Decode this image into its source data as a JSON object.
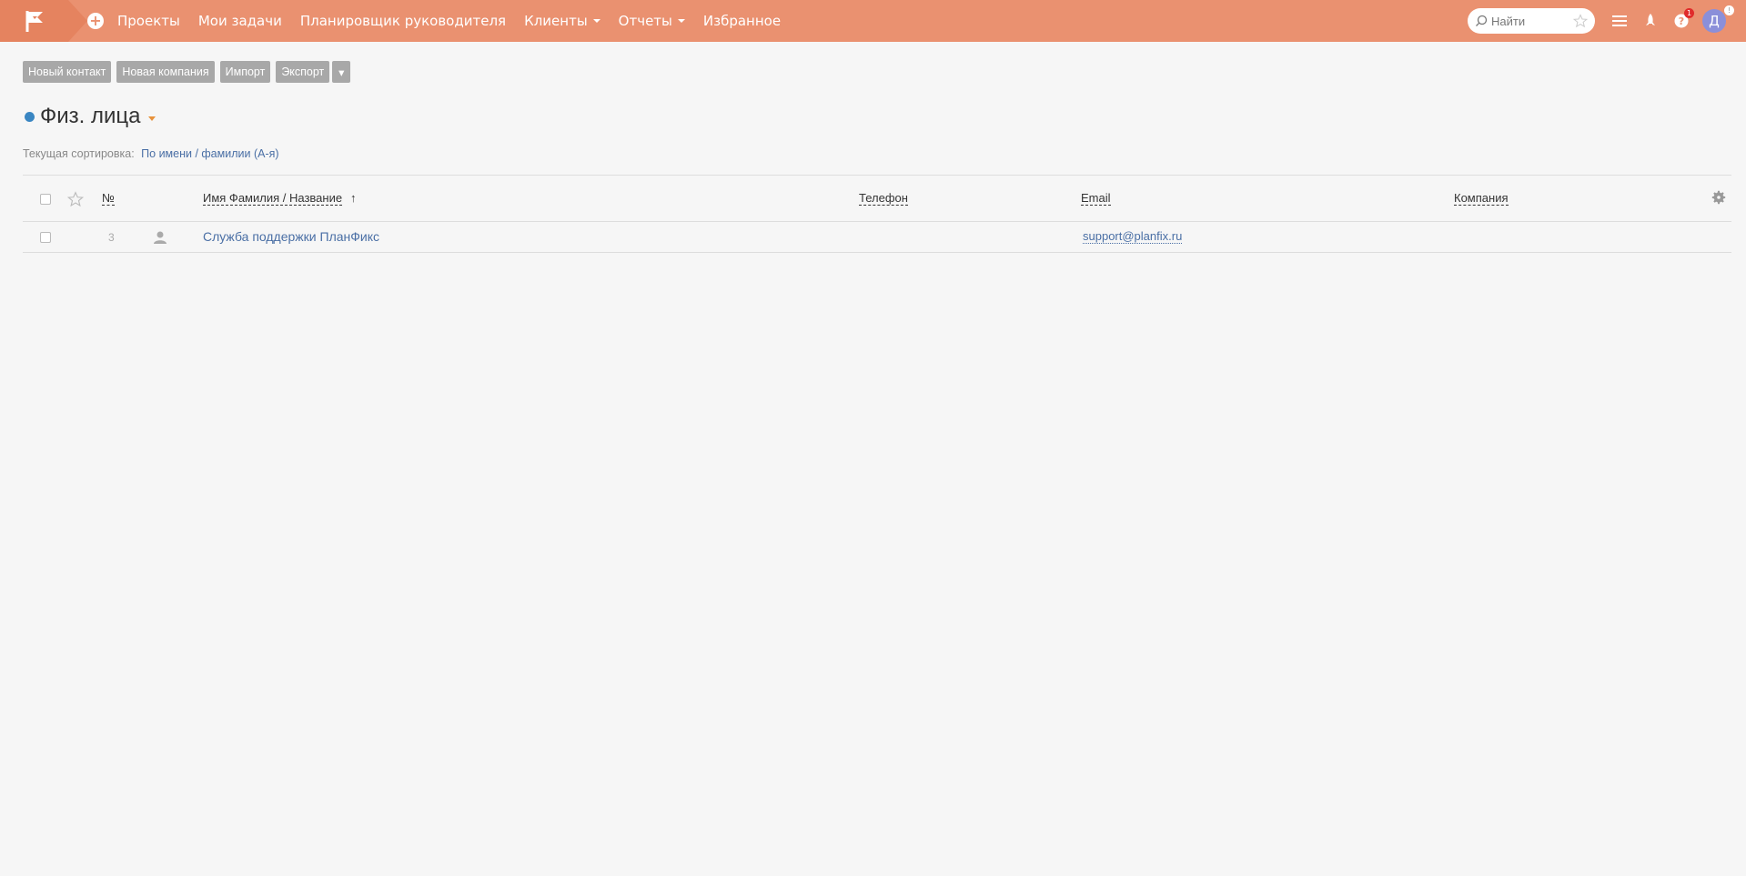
{
  "topbar": {
    "nav": [
      {
        "label": "Проекты",
        "dropdown": false
      },
      {
        "label": "Мои задачи",
        "dropdown": false
      },
      {
        "label": "Планировщик руководителя",
        "dropdown": false
      },
      {
        "label": "Клиенты",
        "dropdown": true
      },
      {
        "label": "Отчеты",
        "dropdown": true
      },
      {
        "label": "Избранное",
        "dropdown": false
      }
    ],
    "search_placeholder": "Найти",
    "help_badge": "1",
    "avatar_letter": "Д",
    "avatar_badge": "!",
    "colors": {
      "bar": "#ea9170",
      "logo_bg": "#e5835f",
      "avatar": "#8b8fd9"
    }
  },
  "toolbar": {
    "new_contact": "Новый контакт",
    "new_company": "Новая компания",
    "import": "Импорт",
    "export": "Экспорт",
    "more": "▾"
  },
  "page": {
    "title": "Физ. лица",
    "sort_label": "Текущая сортировка:",
    "sort_value": "По имени / фамилии (А-я)",
    "accent_dot_color": "#3a86c2"
  },
  "table": {
    "headers": {
      "number": "№",
      "name": "Имя Фамилия / Название",
      "phone": "Телефон",
      "email": "Email",
      "company": "Компания"
    },
    "sort_arrow": "↑",
    "rows": [
      {
        "number": "3",
        "name": "Служба поддержки ПланФикс",
        "phone": "",
        "email": "support@planfix.ru",
        "company": ""
      }
    ]
  }
}
